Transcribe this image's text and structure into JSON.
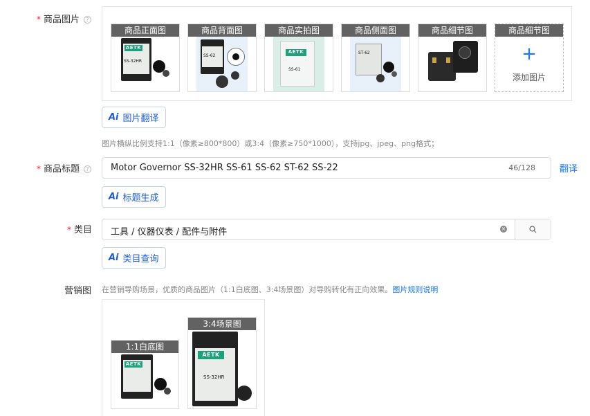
{
  "product_images": {
    "label": "商品图片",
    "help_icon": "question-circle-icon",
    "slots": [
      {
        "caption": "商品正面图"
      },
      {
        "caption": "商品背面图"
      },
      {
        "caption": "商品实拍图"
      },
      {
        "caption": "商品侧面图"
      },
      {
        "caption": "商品细节图"
      },
      {
        "caption": "商品细节图",
        "add_text": "添加图片",
        "plus": "+"
      }
    ],
    "translate_button": {
      "ai": "Ai",
      "label": "图片翻译"
    },
    "hint": "图片横纵比例支持1:1（像素≥800*800）或3:4（像素≥750*1000），支持jpg、jpeg、png格式；"
  },
  "product_title": {
    "label": "商品标题",
    "value": "Motor Governor SS-32HR SS-61 SS-62 ST-62 SS-22",
    "count": "46/128",
    "translate_link": "翻译",
    "generate_button": {
      "ai": "Ai",
      "label": "标题生成"
    }
  },
  "category": {
    "label": "类目",
    "value": "工具 / 仪器仪表 / 配件与附件",
    "clear_icon": "×",
    "query_button": {
      "ai": "Ai",
      "label": "类目查询"
    }
  },
  "marketing_images": {
    "label": "营销图",
    "hint": "在营销导购场景，优质的商品图片（1:1白底图、3:4场景图）对导购转化有正向效果。",
    "rules_link": "图片规则说明",
    "slots": [
      {
        "caption": "1:1白底图"
      },
      {
        "caption": "3:4场景图"
      }
    ]
  },
  "product_labels": {
    "brand": "AETK",
    "models": [
      "SS-32HR",
      "SS-62",
      "SS-61",
      "ST-62",
      "SS-32HR"
    ]
  },
  "colors": {
    "accent": "#1677ff",
    "required": "#f5222d",
    "ai_text": "#1d5bd6"
  }
}
